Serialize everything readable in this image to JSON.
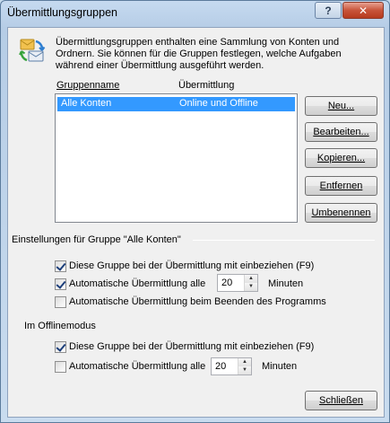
{
  "window": {
    "title": "Übermittlungsgruppen",
    "help_label": "?",
    "close_glyph": "✕"
  },
  "intro_text": "Übermittlungsgruppen enthalten eine Sammlung von Konten und Ordnern. Sie können für die Gruppen festlegen, welche Aufgaben während einer Übermittlung ausgeführt werden.",
  "list": {
    "col_name": "Gruppenname",
    "col_transfer": "Übermittlung",
    "rows": [
      {
        "name": "Alle Konten",
        "transfer": "Online und Offline",
        "selected": true
      }
    ]
  },
  "buttons": {
    "new": "Neu...",
    "edit": "Bearbeiten...",
    "copy": "Kopieren...",
    "remove": "Entfernen",
    "rename": "Umbenennen",
    "close": "Schließen"
  },
  "settings_group": {
    "title": "Einstellungen für Gruppe \"Alle Konten\"",
    "online": {
      "include": {
        "label": "Diese Gruppe bei der Übermittlung mit einbeziehen (F9)",
        "checked": true
      },
      "auto": {
        "label": "Automatische Übermittlung alle",
        "checked": true,
        "value": "20",
        "unit": "Minuten"
      },
      "on_exit": {
        "label": "Automatische Übermittlung beim Beenden des Programms",
        "checked": false
      }
    },
    "offline_title": "Im Offlinemodus",
    "offline": {
      "include": {
        "label": "Diese Gruppe bei der Übermittlung mit einbeziehen (F9)",
        "checked": true
      },
      "auto": {
        "label": "Automatische Übermittlung alle",
        "checked": false,
        "value": "20",
        "unit": "Minuten"
      }
    }
  }
}
